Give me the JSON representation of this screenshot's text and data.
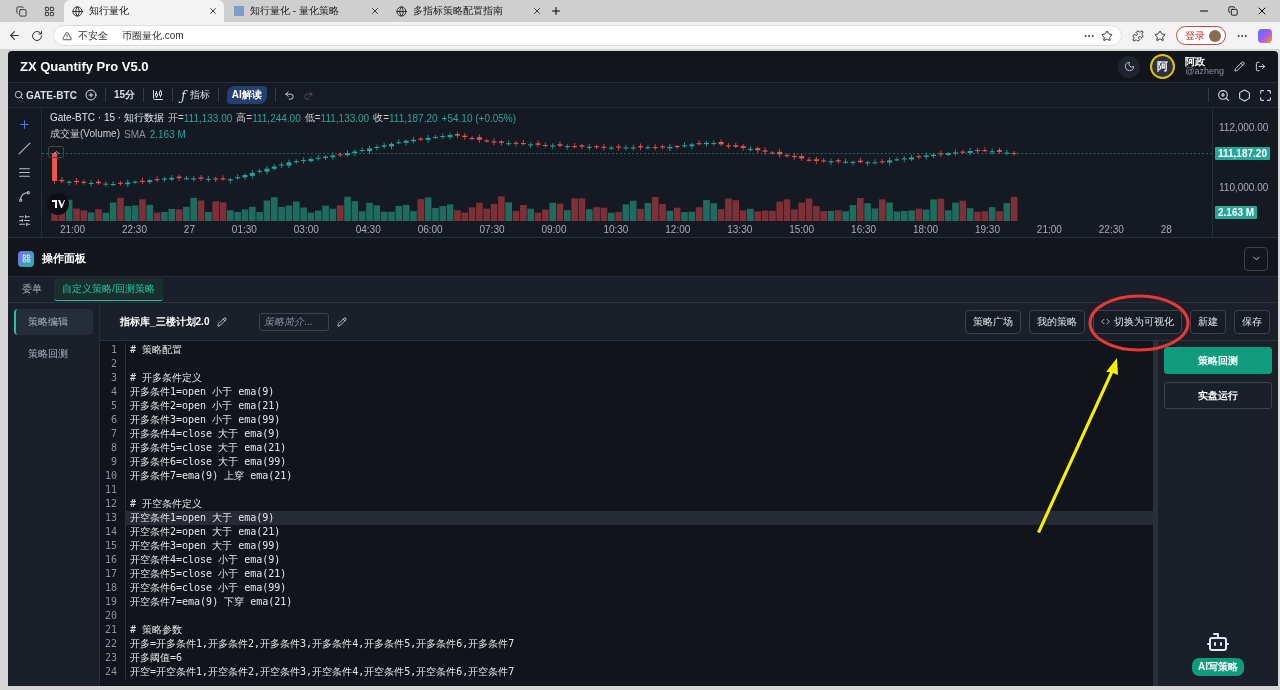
{
  "browser": {
    "tabs": [
      {
        "title": "知行量化",
        "selected": true,
        "kind": "globe"
      },
      {
        "title": "知行量化 - 量化策略",
        "selected": false,
        "kind": "favicon"
      },
      {
        "title": "多指标策略配置指南",
        "selected": false,
        "kind": "globe"
      }
    ],
    "address": {
      "warning": "不安全",
      "url": "币圈量化.com"
    },
    "login_button": "登录"
  },
  "app": {
    "title": "ZX Quantify Pro V5.0",
    "user": {
      "avatar": "阿",
      "name": "阿政",
      "handle": "@azheng"
    }
  },
  "toolbar": {
    "symbol": "GATE-BTC",
    "interval": "15分",
    "indicator_icon": "ƒ",
    "indicator": "指标",
    "ai_button": "AI解读"
  },
  "chart": {
    "legend": {
      "title": "Gate-BTC · 15 · 知行数据",
      "ohlc": [
        {
          "label": "开=",
          "value": "111,133.00"
        },
        {
          "label": "高=",
          "value": "111,244.00"
        },
        {
          "label": "低=",
          "value": "111,133.00"
        },
        {
          "label": "收=",
          "value": "111,187.20"
        }
      ],
      "change": "+54.10 (+0.05%)",
      "volume_label": "成交量(Volume)",
      "volume_ma": "SMA",
      "volume_value": "2.163 M"
    },
    "price_ticks": [
      "112,000.00",
      "110,000.00"
    ],
    "last_price": "111,187.20",
    "volume_badge": "2.163 M",
    "time_ticks": [
      "21:00",
      "22:30",
      "27",
      "01:30",
      "03:00",
      "04:30",
      "06:00",
      "07:30",
      "09:00",
      "10:30",
      "12:00",
      "13:30",
      "15:00",
      "16:30",
      "18:00",
      "19:30",
      "21:00",
      "22:30",
      "28"
    ]
  },
  "panel": {
    "title": "操作面板",
    "tabs": [
      {
        "label": "委单",
        "selected": false
      },
      {
        "label": "自定义策略/回测策略",
        "selected": true
      }
    ],
    "sidebar": [
      {
        "label": "策略编辑",
        "selected": true
      },
      {
        "label": "策略回测",
        "selected": false
      }
    ],
    "strategy_name": "指标库_三楼计划2.0",
    "description": {
      "placeholder": "策略简介..."
    },
    "actions": [
      {
        "label": "策略广场",
        "kind": "plain"
      },
      {
        "label": "我的策略",
        "kind": "plain"
      },
      {
        "label": "切换为可视化",
        "kind": "code"
      },
      {
        "label": "新建",
        "kind": "plain"
      },
      {
        "label": "保存",
        "kind": "plain"
      }
    ],
    "side_buttons": [
      {
        "label": "策略回测",
        "kind": "primary"
      },
      {
        "label": "实盘运行",
        "kind": "outline"
      }
    ],
    "ai_badge": "AI写策略",
    "code": [
      {
        "no": "1",
        "text": "# 策略配置",
        "current": false
      },
      {
        "no": "2",
        "current": false
      },
      {
        "no": "3",
        "text": "# 开多条件定义",
        "current": false
      },
      {
        "no": "4",
        "text": "开多条件1=open 小于 ema(9)",
        "current": false
      },
      {
        "no": "5",
        "text": "开多条件2=open 小于 ema(21)",
        "current": false
      },
      {
        "no": "6",
        "text": "开多条件3=open 小于 ema(99)",
        "current": false
      },
      {
        "no": "7",
        "text": "开多条件4=close 大于 ema(9)",
        "current": false
      },
      {
        "no": "8",
        "text": "开多条件5=close 大于 ema(21)",
        "current": false
      },
      {
        "no": "9",
        "text": "开多条件6=close 大于 ema(99)",
        "current": false
      },
      {
        "no": "10",
        "text": "开多条件7=ema(9) 上穿 ema(21)",
        "current": false
      },
      {
        "no": "11",
        "current": false
      },
      {
        "no": "12",
        "text": "# 开空条件定义",
        "current": false
      },
      {
        "no": "13",
        "text": "开空条件1=open 大于 ema(9)",
        "current": true
      },
      {
        "no": "14",
        "text": "开空条件2=open 大于 ema(21)",
        "current": false
      },
      {
        "no": "15",
        "text": "开空条件3=open 大于 ema(99)",
        "current": false
      },
      {
        "no": "16",
        "text": "开空条件4=close 小于 ema(9)",
        "current": false
      },
      {
        "no": "17",
        "text": "开空条件5=close 小于 ema(21)",
        "current": false
      },
      {
        "no": "18",
        "text": "开空条件6=close 小于 ema(99)",
        "current": false
      },
      {
        "no": "19",
        "text": "开空条件7=ema(9) 下穿 ema(21)",
        "current": false
      },
      {
        "no": "20",
        "current": false
      },
      {
        "no": "21",
        "text": "# 策略参数",
        "current": false
      },
      {
        "no": "22",
        "text": "开多=开多条件1,开多条件2,开多条件3,开多条件4,开多条件5,开多条件6,开多条件7",
        "current": false
      },
      {
        "no": "23",
        "text": "开多阈值=6",
        "current": false
      },
      {
        "no": "24",
        "text": "开空=开空条件1,开空条件2,开空条件3,开空条件4,开空条件5,开空条件6,开空条件7",
        "current": false
      }
    ]
  },
  "annotations": [
    {
      "kind": "ellipse",
      "color": "#e53935"
    },
    {
      "kind": "arrow",
      "color": "#f5f000"
    }
  ]
}
